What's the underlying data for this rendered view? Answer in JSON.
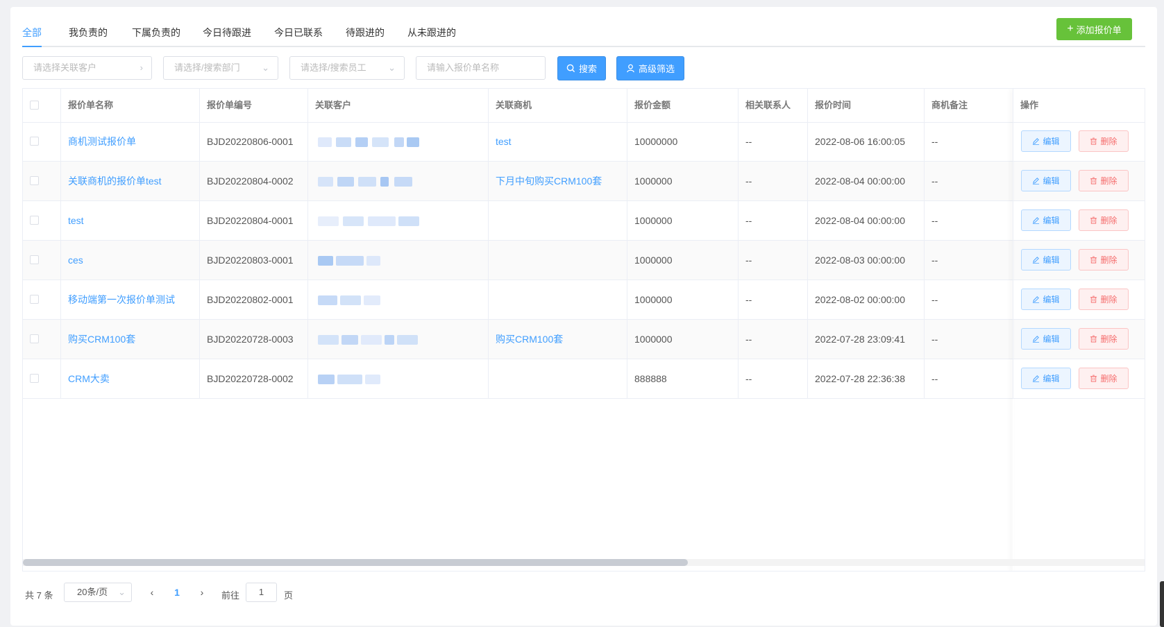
{
  "tabs": [
    "全部",
    "我负责的",
    "下属负责的",
    "今日待跟进",
    "今日已联系",
    "待跟进的",
    "从未跟进的"
  ],
  "add_button": "添加报价单",
  "filters": {
    "customer_placeholder": "请选择关联客户",
    "dept_placeholder": "请选择/搜索部门",
    "staff_placeholder": "请选择/搜索员工",
    "name_placeholder": "请输入报价单名称",
    "search_label": "搜索",
    "advanced_label": "高级筛选"
  },
  "table": {
    "columns": [
      "报价单名称",
      "报价单编号",
      "关联客户",
      "关联商机",
      "报价金额",
      "相关联系人",
      "报价时间",
      "商机备注",
      "操作"
    ],
    "rows": [
      {
        "name": "商机测试报价单",
        "code": "BJD20220806-0001",
        "opportunity": "test",
        "amount": "10000000",
        "contact": "--",
        "time": "2022-08-06 16:00:05",
        "remark": "--"
      },
      {
        "name": "关联商机的报价单test",
        "code": "BJD20220804-0002",
        "opportunity": "下月中旬购买CRM100套",
        "amount": "1000000",
        "contact": "--",
        "time": "2022-08-04 00:00:00",
        "remark": "--"
      },
      {
        "name": "test",
        "code": "BJD20220804-0001",
        "opportunity": "",
        "amount": "1000000",
        "contact": "--",
        "time": "2022-08-04 00:00:00",
        "remark": "--"
      },
      {
        "name": "ces",
        "code": "BJD20220803-0001",
        "opportunity": "",
        "amount": "1000000",
        "contact": "--",
        "time": "2022-08-03 00:00:00",
        "remark": "--"
      },
      {
        "name": "移动端第一次报价单测试",
        "code": "BJD20220802-0001",
        "opportunity": "",
        "amount": "1000000",
        "contact": "--",
        "time": "2022-08-02 00:00:00",
        "remark": "--"
      },
      {
        "name": "购买CRM100套",
        "code": "BJD20220728-0003",
        "opportunity": "购买CRM100套",
        "amount": "1000000",
        "contact": "--",
        "time": "2022-07-28 23:09:41",
        "remark": "--"
      },
      {
        "name": "CRM大卖",
        "code": "BJD20220728-0002",
        "opportunity": "",
        "amount": "888888",
        "contact": "--",
        "time": "2022-07-28 22:36:38",
        "remark": "--"
      }
    ],
    "edit_label": "编辑",
    "delete_label": "删除"
  },
  "pagination": {
    "total_text": "共 7 条",
    "page_size": "20条/页",
    "current_page": "1",
    "goto_label": "前往",
    "goto_value": "1",
    "page_suffix": "页"
  },
  "colors": {
    "primary": "#409eff",
    "success": "#67c23a",
    "danger": "#f56c6c"
  }
}
